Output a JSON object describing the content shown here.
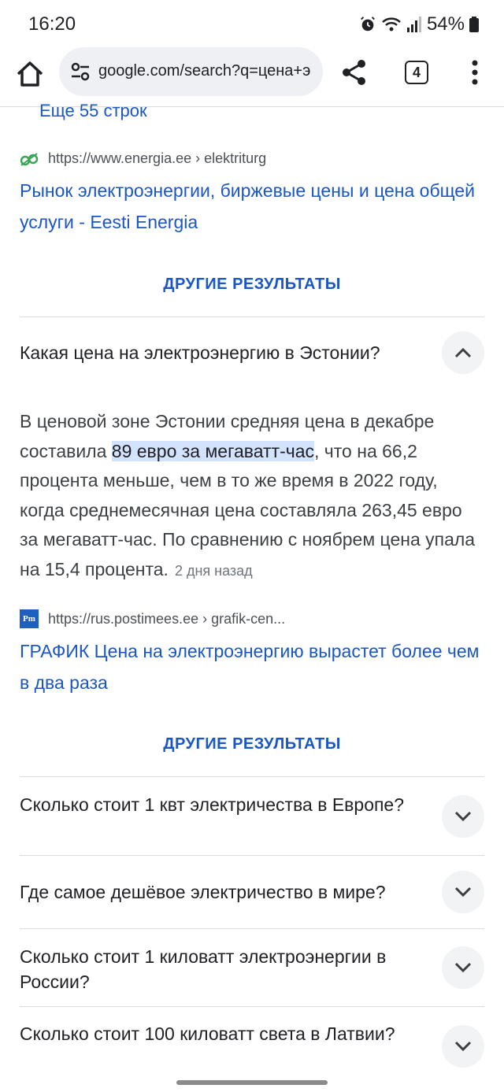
{
  "status": {
    "time": "16:20",
    "battery": "54%"
  },
  "toolbar": {
    "url": "google.com/search?q=цена+э",
    "tab_count": "4"
  },
  "results": {
    "more_rows": "Еще 55 строк",
    "energia": {
      "source": "https://www.energia.ee › elektriturg",
      "title": "Рынок электроэнергии, биржевые цены и цена общей услуги - Eesti Energia"
    },
    "more_results_label_1": "ДРУГИЕ РЕЗУЛЬТАТЫ",
    "faq_open": {
      "question": "Какая цена на электроэнергию в Эстонии?",
      "answer_pre": "В ценовой зоне Эстонии средняя цена в декабре составила ",
      "answer_highlight": "89 евро за мегаватт-час",
      "answer_post": ", что на 66,2 процента меньше, чем в то же время в 2022 году, когда среднемесячная цена составляла 263,45 евро за мегаватт-час. По сравнению с ноябрем цена упала на 15,4 процента.",
      "date": "2 дня назад"
    },
    "postimees": {
      "favicon": "Pm",
      "source": "https://rus.postimees.ee › grafik-cen...",
      "title": "ГРАФИК Цена на электроэнергию вырастет более чем в два раза"
    },
    "more_results_label_2": "ДРУГИЕ РЕЗУЛЬТАТЫ",
    "faq_collapsed": [
      "Сколько стоит 1 квт электричества в Европе?",
      "Где самое дешёвое электричество в мире?",
      "Сколько стоит 1 киловатт электроэнергии в России?",
      "Сколько стоит 100 киловатт света в Латвии?"
    ]
  },
  "icons": {
    "home": "home-icon",
    "site_settings": "tune-icon",
    "share": "share-icon",
    "menu": "more-vert-icon",
    "expand": "chevron-down-icon",
    "collapse": "chevron-up-icon"
  },
  "colors": {
    "link": "#1a56c4",
    "highlight": "#d3e3fd",
    "chip": "#f1f3f4"
  }
}
